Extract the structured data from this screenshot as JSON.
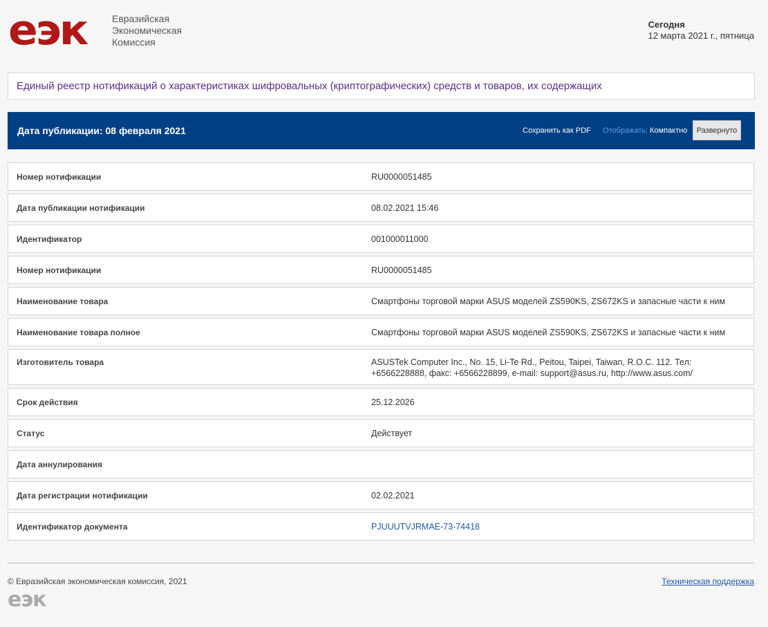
{
  "header": {
    "logo_text": "еэк",
    "org_name_lines": [
      "Евразийская",
      "Экономическая",
      "Комиссия"
    ],
    "today_label": "Сегодня",
    "today_date": "12 марта 2021 г., пятница"
  },
  "title": "Единый реестр нотификаций о характеристиках шифровальных (криптографических) средств и товаров, их содержащих",
  "toolbar": {
    "publication_date": "Дата публикации: 08 февраля 2021",
    "save_pdf": "Сохранить как PDF",
    "display_label": "Отображать:",
    "compact": "Компактно",
    "expanded": "Развернуто"
  },
  "rows": [
    {
      "label": "Номер нотификации",
      "value": "RU0000051485"
    },
    {
      "label": "Дата публикации нотификации",
      "value": "08.02.2021 15:46"
    },
    {
      "label": "Идентификатор",
      "value": "001000011000"
    },
    {
      "label": "Номер нотификации",
      "value": "RU0000051485"
    },
    {
      "label": "Наименование товара",
      "value": "Смартфоны торговой марки ASUS моделей ZS590KS, ZS672KS и запасные части к ним"
    },
    {
      "label": "Наименование товара полное",
      "value": "Смартфоны торговой марки ASUS моделей ZS590KS, ZS672KS и запасные части к ним"
    },
    {
      "label": "Изготовитель товара",
      "value": "ASUSTek Computer Inc., No. 15, Li-Te Rd., Peitou, Taipei, Taiwan, R.O.C. 112. Тел: +6566228888, факс: +6566228899, e-mail: support@asus.ru, http://www.asus.com/"
    },
    {
      "label": "Срок действия",
      "value": "25.12.2026"
    },
    {
      "label": "Статус",
      "value": "Действует"
    },
    {
      "label": "Дата аннулирования",
      "value": ""
    },
    {
      "label": "Дата регистрации нотификации",
      "value": "02.02.2021"
    },
    {
      "label": "Идентификатор документа",
      "value": "PJUUUTVJRMAE-73-74418"
    }
  ],
  "footer": {
    "copyright": "© Евразийская экономическая комиссия, 2021",
    "support_link": "Техническая поддержка",
    "logo_text": "еэк"
  },
  "colors": {
    "brand_red": "#b01818",
    "toolbar_blue": "#013f85",
    "title_purple": "#5b2d86",
    "link_blue": "#1a5aa6"
  }
}
